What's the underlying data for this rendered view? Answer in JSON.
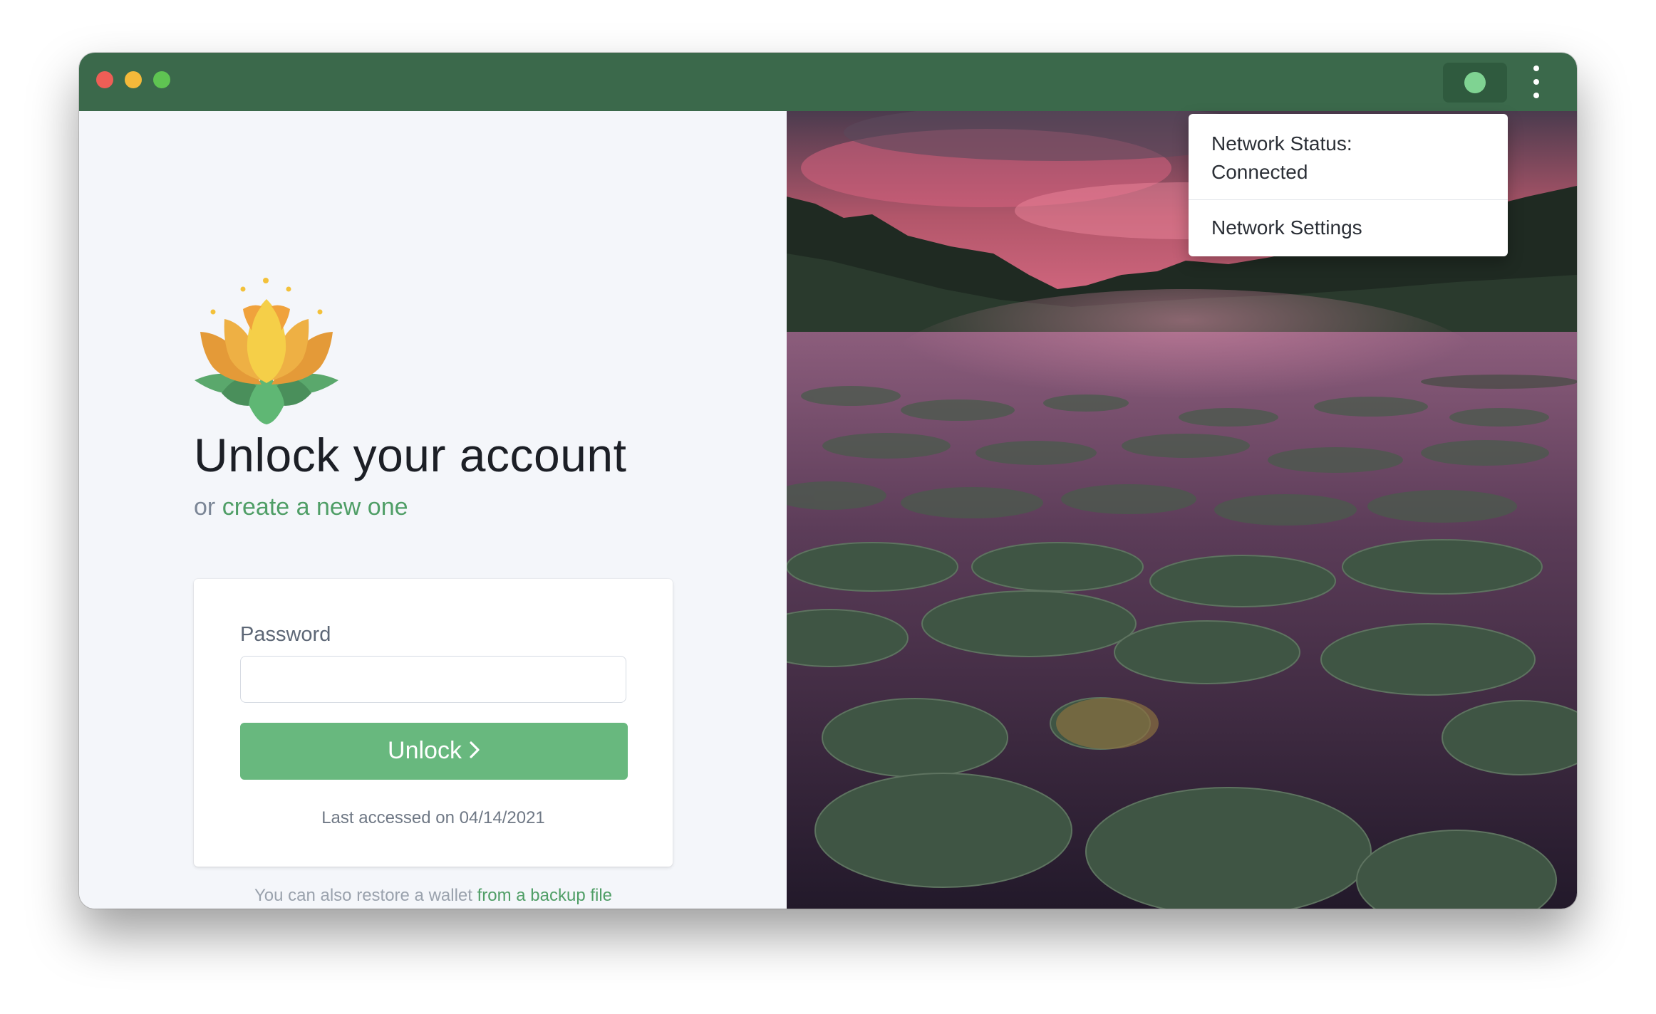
{
  "window": {
    "title_bar": {
      "traffic_lights": [
        "red",
        "yellow",
        "green"
      ],
      "network_indicator": {
        "icon": "status-dot-icon",
        "color": "#7fd392"
      },
      "menu_icon": "kebab-menu-icon"
    }
  },
  "login": {
    "logo": "lotus-logo",
    "heading": "Unlock your account",
    "subline_prefix": "or",
    "create_link": "create a new one",
    "password_label": "Password",
    "password_value": "",
    "password_placeholder": "",
    "unlock_button": "Unlock",
    "unlock_icon": "chevron-right-icon",
    "last_accessed": "Last accessed on 04/14/2021",
    "restore_prefix": "You can also restore a wallet",
    "restore_link": "from a backup file"
  },
  "network_menu": {
    "status_text": "Network Status: Connected",
    "settings_label": "Network Settings"
  },
  "colors": {
    "titlebar": "#3b694b",
    "accent": "#68b87e",
    "link": "#4f9e66"
  }
}
